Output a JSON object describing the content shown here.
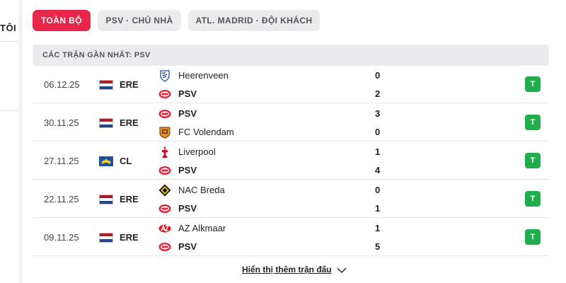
{
  "sidebar": {
    "partial_label": "TÔI"
  },
  "tabs": [
    {
      "label": "TOÀN BỘ",
      "active": true
    },
    {
      "label": "PSV · CHỦ NHÀ",
      "active": false
    },
    {
      "label": "ATL. MADRID · ĐỘI KHÁCH",
      "active": false
    }
  ],
  "section_title": "CÁC TRẬN GẦN NHẤT: PSV",
  "matches": [
    {
      "date": "06.12.25",
      "flag": "netherlands-flag-icon",
      "competition": "ERE",
      "home": {
        "name": "Heerenveen",
        "crest": "heerenveen-crest-icon",
        "score": "0"
      },
      "away": {
        "name": "PSV",
        "crest": "psv-crest-icon",
        "score": "2"
      },
      "result": "T"
    },
    {
      "date": "30.11.25",
      "flag": "netherlands-flag-icon",
      "competition": "ERE",
      "home": {
        "name": "PSV",
        "crest": "psv-crest-icon",
        "score": "3"
      },
      "away": {
        "name": "FC Volendam",
        "crest": "volendam-crest-icon",
        "score": "0"
      },
      "result": "T"
    },
    {
      "date": "27.11.25",
      "flag": "europe-flag-icon",
      "competition": "CL",
      "home": {
        "name": "Liverpool",
        "crest": "liverpool-crest-icon",
        "score": "1"
      },
      "away": {
        "name": "PSV",
        "crest": "psv-crest-icon",
        "score": "4"
      },
      "result": "T"
    },
    {
      "date": "22.11.25",
      "flag": "netherlands-flag-icon",
      "competition": "ERE",
      "home": {
        "name": "NAC Breda",
        "crest": "nac-breda-crest-icon",
        "score": "0"
      },
      "away": {
        "name": "PSV",
        "crest": "psv-crest-icon",
        "score": "1"
      },
      "result": "T"
    },
    {
      "date": "09.11.25",
      "flag": "netherlands-flag-icon",
      "competition": "ERE",
      "home": {
        "name": "AZ Alkmaar",
        "crest": "az-alkmaar-crest-icon",
        "score": "1"
      },
      "away": {
        "name": "PSV",
        "crest": "psv-crest-icon",
        "score": "5"
      },
      "result": "T"
    }
  ],
  "show_more_label": "Hiển thị thêm trận đấu",
  "colors": {
    "accent": "#e8264a",
    "win": "#1fae4b",
    "tab_inactive_bg": "#ececef",
    "header_bg": "#ececef"
  }
}
